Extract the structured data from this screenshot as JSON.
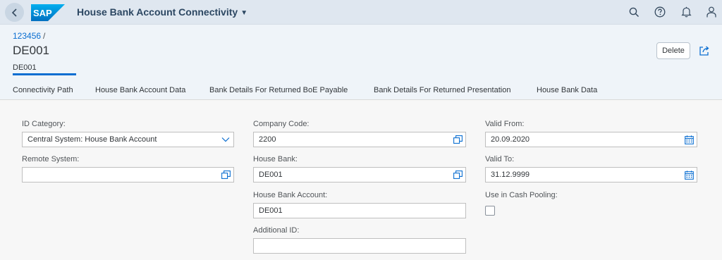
{
  "shell": {
    "logo_text": "SAP",
    "app_title": "House Bank Account Connectivity",
    "brand_color": "#0a6ed1",
    "icons": [
      "back-icon",
      "search-icon",
      "help-icon",
      "notifications-icon",
      "user-icon"
    ]
  },
  "header": {
    "breadcrumb": "123456",
    "breadcrumb_separator": "/",
    "title": "DE001",
    "subtitle": "DE001",
    "delete_label": "Delete"
  },
  "tabs": [
    {
      "label": "Connectivity Path",
      "active": true
    },
    {
      "label": "House Bank Account Data",
      "active": false
    },
    {
      "label": "Bank Details For Returned BoE Payable",
      "active": false
    },
    {
      "label": "Bank Details For Returned Presentation",
      "active": false
    },
    {
      "label": "House Bank Data",
      "active": false
    }
  ],
  "form": {
    "id_category": {
      "label": "ID Category:",
      "value": "Central System: House Bank Account"
    },
    "remote_system": {
      "label": "Remote System:",
      "value": ""
    },
    "company_code": {
      "label": "Company Code:",
      "value": "2200"
    },
    "house_bank": {
      "label": "House Bank:",
      "value": "DE001"
    },
    "house_bank_account": {
      "label": "House Bank Account:",
      "value": "DE001"
    },
    "additional_id": {
      "label": "Additional ID:",
      "value": ""
    },
    "valid_from": {
      "label": "Valid From:",
      "value": "20.09.2020"
    },
    "valid_to": {
      "label": "Valid To:",
      "value": "31.12.9999"
    },
    "use_in_cash_pooling": {
      "label": "Use in Cash Pooling:",
      "checked": false
    }
  }
}
